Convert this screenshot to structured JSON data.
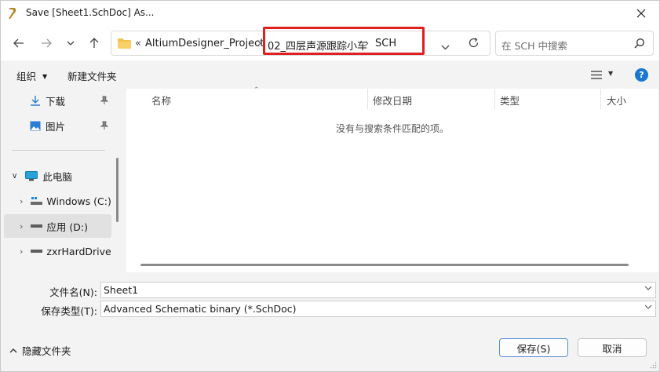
{
  "window": {
    "title": "Save [Sheet1.SchDoc] As..."
  },
  "address": {
    "overflow": "«",
    "segments": [
      "AltiumDesigner_Project",
      "02_四层声源跟踪小车",
      "SCH"
    ],
    "separator": "›"
  },
  "search": {
    "placeholder": "在 SCH 中搜索"
  },
  "toolbar": {
    "organize": "组织",
    "new_folder": "新建文件夹"
  },
  "navpane": {
    "quick_items": [
      {
        "label": "下载",
        "icon": "download-icon"
      },
      {
        "label": "图片",
        "icon": "pictures-icon"
      }
    ],
    "this_pc": "此电脑",
    "drives": [
      {
        "label": "Windows (C:)",
        "icon": "windows-drive-icon"
      },
      {
        "label": "应用 (D:)",
        "icon": "drive-icon"
      },
      {
        "label": "zxrHardDrive",
        "icon": "drive-icon"
      }
    ]
  },
  "filelist": {
    "columns": [
      "名称",
      "修改日期",
      "类型",
      "大小"
    ],
    "empty_message": "没有与搜索条件匹配的项。"
  },
  "form": {
    "filename_label": "文件名(N):",
    "filename_value": "Sheet1",
    "filetype_label": "保存类型(T):",
    "filetype_value": "Advanced Schematic binary (*.SchDoc)"
  },
  "footer": {
    "hide_folders": "隐藏文件夹",
    "save": "保存(S)",
    "cancel": "取消"
  },
  "colors": {
    "highlight": "#e02020",
    "accent": "#1877d1"
  }
}
